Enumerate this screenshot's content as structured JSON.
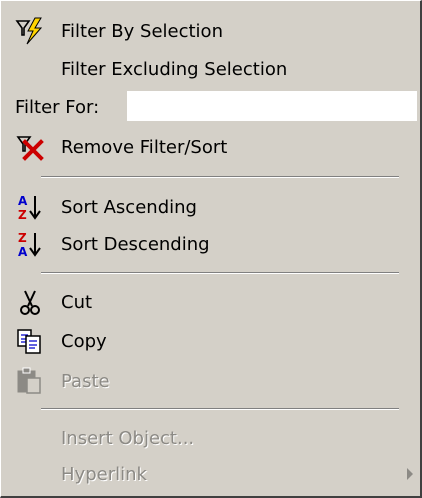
{
  "menu": {
    "items": [
      {
        "label": "Filter By Selection",
        "icon": "filter-lightning-icon"
      },
      {
        "label": "Filter Excluding Selection"
      },
      {
        "label": "Filter For:",
        "input_value": ""
      },
      {
        "label": "Remove Filter/Sort",
        "icon": "remove-filter-icon"
      },
      {
        "label": "Sort Ascending",
        "icon": "sort-ascending-icon"
      },
      {
        "label": "Sort Descending",
        "icon": "sort-descending-icon"
      },
      {
        "label": "Cut",
        "icon": "scissors-icon"
      },
      {
        "label": "Copy",
        "icon": "copy-icon"
      },
      {
        "label": "Paste",
        "icon": "paste-icon",
        "disabled": true
      },
      {
        "label": "Insert Object...",
        "disabled": true
      },
      {
        "label": "Hyperlink",
        "disabled": true,
        "submenu": true
      }
    ]
  },
  "colors": {
    "menu_bg": "#d4d0c8",
    "disabled_text": "#8c8a85",
    "accent_red": "#cc0000",
    "accent_blue": "#0000cc"
  }
}
